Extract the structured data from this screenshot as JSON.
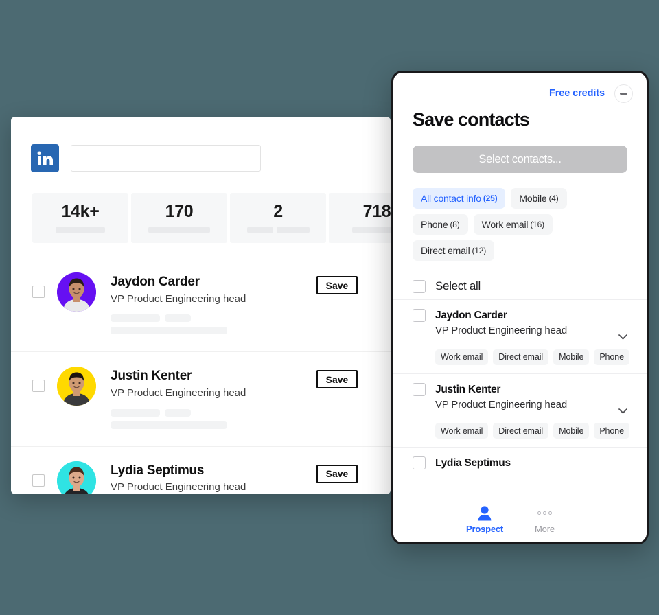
{
  "background_color": "#4c6a72",
  "linkedin_window": {
    "logo_icon": "linkedin-logo-icon",
    "search": {
      "value": "",
      "placeholder": ""
    },
    "stats": [
      {
        "value": "14k+",
        "bars": [
          72
        ]
      },
      {
        "value": "170",
        "bars": [
          90
        ]
      },
      {
        "value": "2",
        "bars": [
          38,
          48
        ]
      },
      {
        "value": "718",
        "bars": [
          72
        ]
      }
    ],
    "save_button_label": "Save",
    "people": [
      {
        "name": "Jaydon Carder",
        "title": "VP Product Engineering head",
        "avatar_color": "#6610f2",
        "skeleton": [
          [
            72,
            38
          ],
          [
            170
          ]
        ]
      },
      {
        "name": "Justin Kenter",
        "title": "VP Product Engineering head",
        "avatar_color": "#ffd900",
        "skeleton": [
          [
            72,
            38
          ],
          [
            170
          ]
        ]
      },
      {
        "name": "Lydia Septimus",
        "title": "VP Product Engineering head",
        "avatar_color": "#2fe3e3",
        "skeleton": [
          [
            72,
            38
          ],
          [
            170
          ]
        ]
      }
    ]
  },
  "panel": {
    "free_credits_label": "Free credits",
    "minimize_icon": "minimize-icon",
    "title": "Save contacts",
    "select_contacts_label": "Select contacts...",
    "accent_color": "#2563ff",
    "filter_chips": [
      {
        "label": "All contact info",
        "count": "(25)",
        "active": true
      },
      {
        "label": "Mobile",
        "count": "(4)",
        "active": false
      },
      {
        "label": "Phone",
        "count": "(8)",
        "active": false
      },
      {
        "label": "Work email",
        "count": "(16)",
        "active": false
      },
      {
        "label": "Direct email",
        "count": "(12)",
        "active": false
      }
    ],
    "select_all_label": "Select all",
    "contacts": [
      {
        "name": "Jaydon Carder",
        "title": "VP Product Engineering head",
        "tags": [
          "Work email",
          "Direct email",
          "Mobile",
          "Phone"
        ],
        "expand_icon": "chevron-down-icon"
      },
      {
        "name": "Justin Kenter",
        "title": "VP Product Engineering head",
        "tags": [
          "Work email",
          "Direct email",
          "Mobile",
          "Phone"
        ],
        "expand_icon": "chevron-down-icon"
      },
      {
        "name": "Lydia Septimus",
        "title": "",
        "tags": [],
        "expand_icon": "chevron-down-icon"
      }
    ],
    "bottom_nav": [
      {
        "label": "Prospect",
        "icon": "person-icon",
        "active": true
      },
      {
        "label": "More",
        "icon": "ellipsis-icon",
        "active": false
      }
    ]
  }
}
